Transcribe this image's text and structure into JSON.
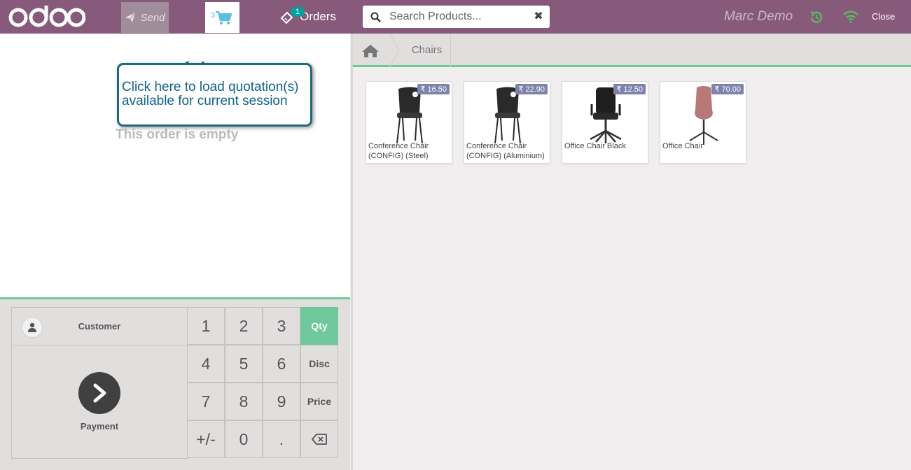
{
  "topbar": {
    "logo_text": "odoo",
    "send_label": "Send",
    "cart_count": "3",
    "orders_badge": "1",
    "orders_label": "Orders",
    "search_placeholder": "Search Products...",
    "cashier_name": "Marc Demo",
    "close_label": "Close"
  },
  "order": {
    "empty_message": "This order is empty",
    "tooltip_text": "Click here to load quotation(s) available for current session"
  },
  "actionpad": {
    "customer_label": "Customer",
    "payment_label": "Payment"
  },
  "numpad": {
    "keys": [
      "1",
      "2",
      "3",
      "Qty",
      "4",
      "5",
      "6",
      "Disc",
      "7",
      "8",
      "9",
      "Price",
      "+/-",
      "0",
      ".",
      "⌫"
    ],
    "active_mode": "Qty"
  },
  "breadcrumb": {
    "category": "Chairs"
  },
  "products": [
    {
      "name": "Conference Chair (CONFIG) (Steel)",
      "price": "₹ 16.50",
      "color": "#2a2a2a"
    },
    {
      "name": "Conference Chair (CONFIG) (Aluminium)",
      "price": "₹ 22.90",
      "color": "#2a2a2a"
    },
    {
      "name": "Office Chair Black",
      "price": "₹ 12.50",
      "color": "#1e1e1e"
    },
    {
      "name": "Office Chair",
      "price": "₹ 70.00",
      "color": "#b87878"
    }
  ],
  "colors": {
    "topbar": "#875a7b",
    "accent": "#6ec89b",
    "tooltip_border": "#1b6a83",
    "price_tag": "#7f82ac"
  }
}
